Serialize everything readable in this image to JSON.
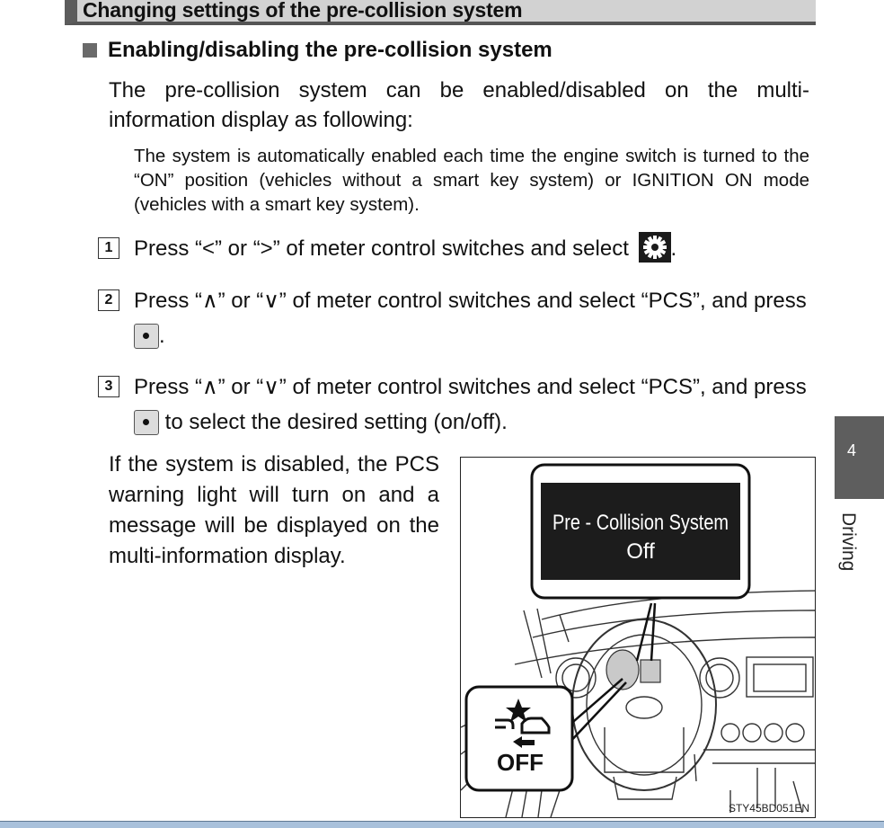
{
  "section_title": "Changing settings of the pre-collision system",
  "subheading": "Enabling/disabling the pre-collision system",
  "intro": "The pre-collision system can be enabled/disabled on the multi-information display as following:",
  "note": "The system is automatically enabled each time the engine switch is turned to the “ON” position (vehicles without a smart key system) or IGNITION ON mode (vehicles with a smart key system).",
  "steps": [
    {
      "num": "1",
      "text_before": "Press “<” or “>” of meter control switches and select ",
      "icon": "gear-icon",
      "text_after": "."
    },
    {
      "num": "2",
      "text_before": "Press “∧” or “∨” of meter control switches and select “PCS”, and press ",
      "icon": "enter-button-icon",
      "text_after": "."
    },
    {
      "num": "3",
      "text_before": "Press “∧” or “∨” of meter control switches and select “PCS”, and press ",
      "icon": "enter-button-icon",
      "text_after": " to select the desired setting (on/off)."
    }
  ],
  "side_text": "If the system is disabled, the PCS warning light will turn on and a message will be displayed on the multi-information display.",
  "figure": {
    "display_message_line1": "Pre - Collision System",
    "display_message_line2": "Off",
    "warning_light_label": "OFF",
    "figure_code": "STY45BD051EN"
  },
  "chapter": {
    "number": "4",
    "label": "Driving"
  }
}
